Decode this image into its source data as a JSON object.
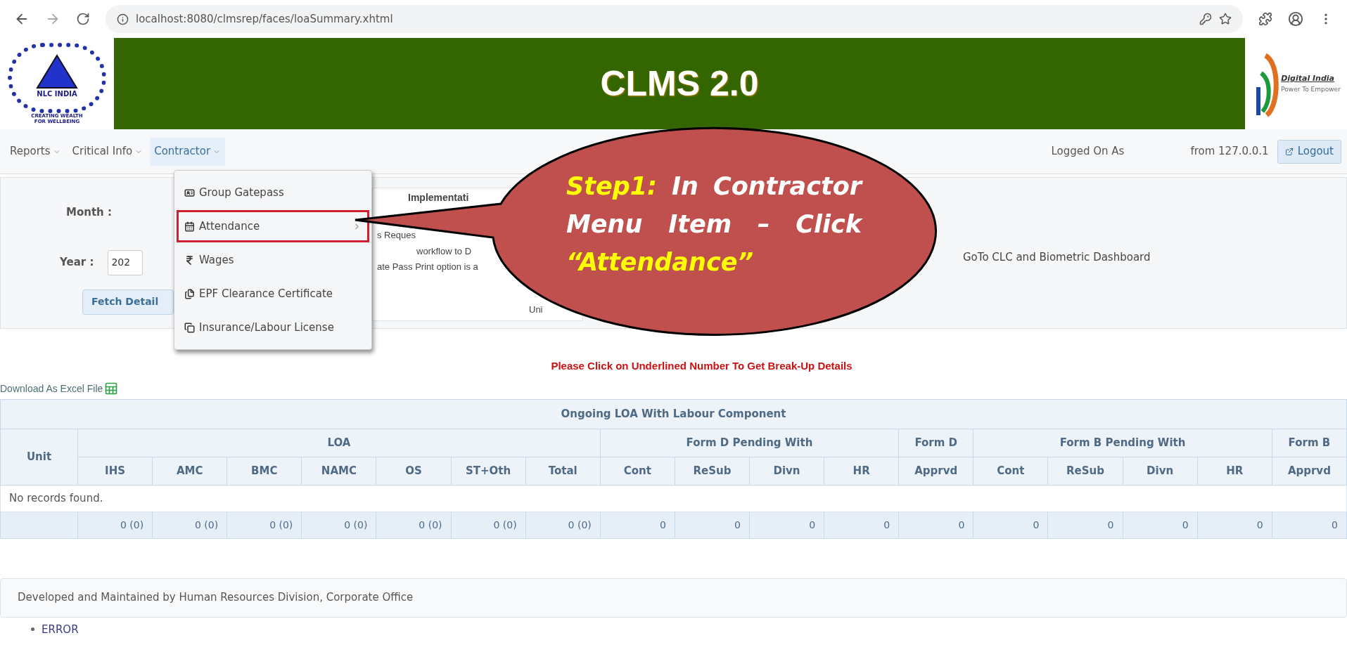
{
  "browser": {
    "url": "localhost:8080/clmsrep/faces/loaSummary.xhtml"
  },
  "header": {
    "title": "CLMS 2.0",
    "left_logo": {
      "name": "NLC INDIA",
      "tagline_1": "CREATING WEALTH",
      "tagline_2": "FOR WELLBEING"
    },
    "right_logo": {
      "name": "Digital India",
      "tagline": "Power To Empower"
    }
  },
  "menubar": {
    "items": [
      {
        "label": "Reports",
        "open": false
      },
      {
        "label": "Critical Info",
        "open": false
      },
      {
        "label": "Contractor",
        "open": true
      }
    ],
    "logged_on_label": "Logged On As",
    "logged_on_from": "from 127.0.0.1",
    "logout": "Logout"
  },
  "dropdown": {
    "items": [
      {
        "label": "Group Gatepass",
        "submenu": false,
        "highlighted": false
      },
      {
        "label": "Attendance",
        "submenu": true,
        "highlighted": true
      },
      {
        "label": "Wages",
        "submenu": false,
        "highlighted": false
      },
      {
        "label": "EPF Clearance Certificate",
        "submenu": false,
        "highlighted": false
      },
      {
        "label": "Insurance/Labour License",
        "submenu": false,
        "highlighted": false
      }
    ]
  },
  "filters": {
    "month_label": "Month :",
    "year_label": "Year :",
    "year_value": "202",
    "fetch_button": "Fetch Detail"
  },
  "notice_box": {
    "heading": "Implementati",
    "lines": [
      "s Reques",
      "workflow to D",
      "ate Pass Print option is a",
      "Uni"
    ]
  },
  "dashboard_link": "GoTo CLC and Biometric Dashboard",
  "callout": {
    "segments": [
      {
        "text": "Step1:",
        "highlight": true
      },
      {
        "text": " In Contractor Menu Item – Click ",
        "highlight": false
      },
      {
        "text": "“Attendance”",
        "highlight": true
      }
    ]
  },
  "instruction": "Please Click on Underlined Number To Get Break-Up Details",
  "download_link": "Download As Excel File",
  "table": {
    "title": "Ongoing LOA With Labour Component",
    "unit_header": "Unit",
    "groups": [
      {
        "label": "LOA",
        "columns": [
          "IHS",
          "AMC",
          "BMC",
          "NAMC",
          "OS",
          "ST+Oth",
          "Total"
        ]
      },
      {
        "label": "Form D Pending With",
        "columns": [
          "Cont",
          "ReSub",
          "Divn",
          "HR"
        ]
      },
      {
        "label": "Form D",
        "columns": [
          "Apprvd"
        ]
      },
      {
        "label": "Form B Pending With",
        "columns": [
          "Cont",
          "ReSub",
          "Divn",
          "HR"
        ]
      },
      {
        "label": "Form B",
        "columns": [
          "Apprvd"
        ]
      }
    ],
    "empty_message": "No records found.",
    "totals": [
      "0 (0)",
      "0 (0)",
      "0 (0)",
      "0 (0)",
      "0 (0)",
      "0 (0)",
      "0 (0)",
      "0",
      "0",
      "0",
      "0",
      "0",
      "0",
      "0",
      "0",
      "0",
      "0"
    ]
  },
  "footer": "Developed and Maintained by Human Resources Division, Corporate Office",
  "messages": [
    "ERROR"
  ]
}
